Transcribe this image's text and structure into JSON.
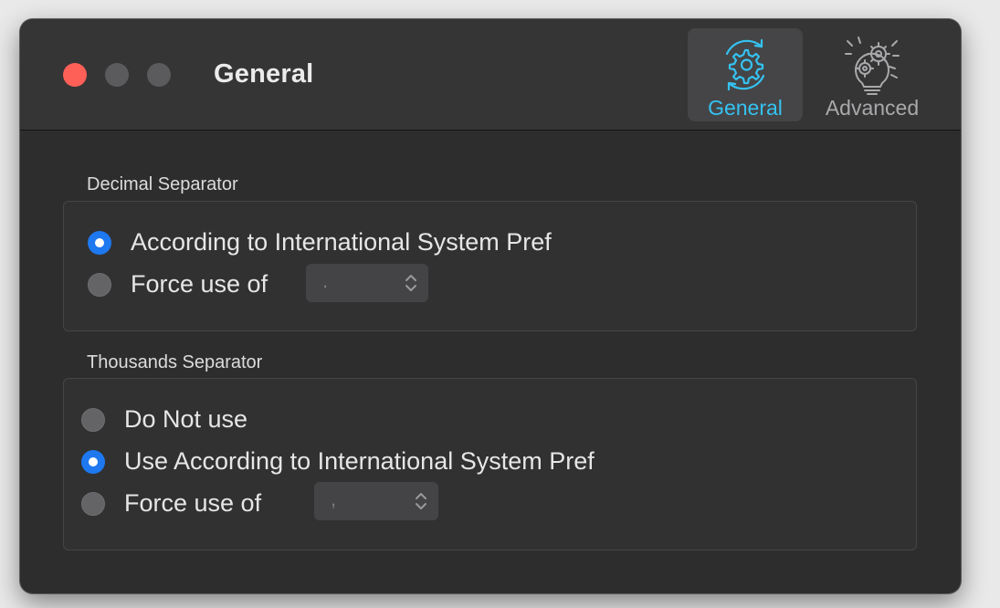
{
  "window": {
    "title": "General"
  },
  "toolbar": {
    "tabs": [
      {
        "label": "General",
        "icon": "gear-cycle-icon",
        "selected": true
      },
      {
        "label": "Advanced",
        "icon": "gears-lightbulb-icon",
        "selected": false
      }
    ]
  },
  "decimal": {
    "title": "Decimal Separator",
    "options": [
      {
        "label": "According to International System Pref",
        "selected": true
      },
      {
        "label": "Force use of",
        "selected": false
      }
    ],
    "popup_value": "."
  },
  "thousands": {
    "title": "Thousands Separator",
    "options": [
      {
        "label": "Do Not use",
        "selected": false
      },
      {
        "label": "Use According to International System Pref",
        "selected": true
      },
      {
        "label": "Force use of",
        "selected": false
      }
    ],
    "popup_value": ","
  },
  "colors": {
    "accent": "#35c2f1",
    "radio_selected": "#1e78f0",
    "close_button": "#fe5f57"
  }
}
